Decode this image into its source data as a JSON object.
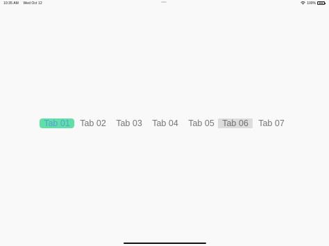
{
  "status_bar": {
    "time": "10:35 AM",
    "date": "Wed Oct 12",
    "battery": "100%"
  },
  "tab_bar": {
    "selected_index": 0,
    "highlighted_index": 5,
    "tabs": [
      {
        "label": "Tab 01"
      },
      {
        "label": "Tab 02"
      },
      {
        "label": "Tab 03"
      },
      {
        "label": "Tab 04"
      },
      {
        "label": "Tab 05"
      },
      {
        "label": "Tab 06"
      },
      {
        "label": "Tab 07"
      }
    ]
  },
  "colors": {
    "selected_background": "#5fe0a6",
    "selected_text": "#5e9bd9",
    "highlighted_background": "#dcdcdc",
    "tab_text": "#757575"
  }
}
